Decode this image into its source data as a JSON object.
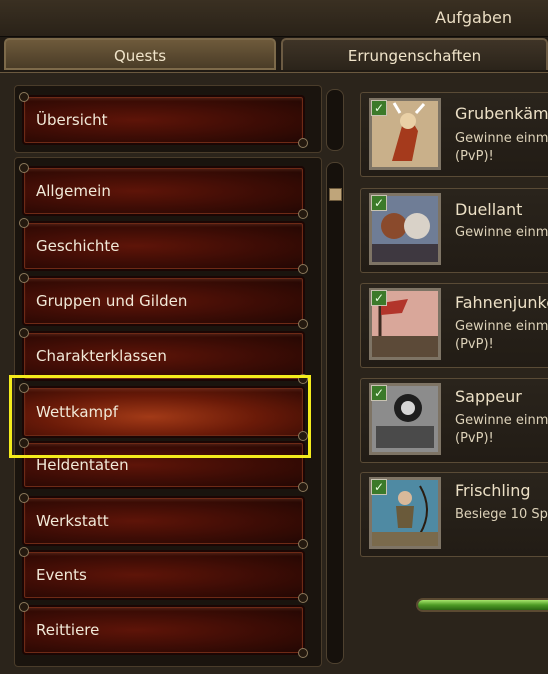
{
  "window": {
    "title": "Aufgaben"
  },
  "tabs": [
    {
      "label": "Quests"
    },
    {
      "label": "Errungenschaften"
    }
  ],
  "categories": {
    "overview": "Übersicht",
    "items": [
      {
        "label": "Allgemein"
      },
      {
        "label": "Geschichte"
      },
      {
        "label": "Gruppen und Gilden"
      },
      {
        "label": "Charakterklassen"
      },
      {
        "label": "Wettkampf"
      },
      {
        "label": "Heldentaten"
      },
      {
        "label": "Werkstatt"
      },
      {
        "label": "Events"
      },
      {
        "label": "Reittiere"
      }
    ],
    "selected": "Wettkampf"
  },
  "achievements": [
    {
      "title": "Grubenkämpf",
      "desc_line1": "Gewinne einm",
      "desc_line2": "(PvP)!",
      "completed": true,
      "icon": "pit-fighter-icon"
    },
    {
      "title": "Duellant",
      "desc_line1": "Gewinne einm",
      "desc_line2": "",
      "completed": true,
      "icon": "duelist-icon"
    },
    {
      "title": "Fahnenjunke",
      "desc_line1": "Gewinne einm",
      "desc_line2": "(PvP)!",
      "completed": true,
      "icon": "banner-icon"
    },
    {
      "title": "Sappeur",
      "desc_line1": "Gewinne einm",
      "desc_line2": "(PvP)!",
      "completed": true,
      "icon": "cannon-icon"
    },
    {
      "title": "Frischling",
      "desc_line1": "Besiege 10 Sp",
      "desc_line2": "",
      "completed": true,
      "icon": "archer-icon"
    }
  ],
  "colors": {
    "accent_highlight": "#f4ec1c",
    "button_red": "#5e1408",
    "progress_green": "#4d9a25"
  }
}
